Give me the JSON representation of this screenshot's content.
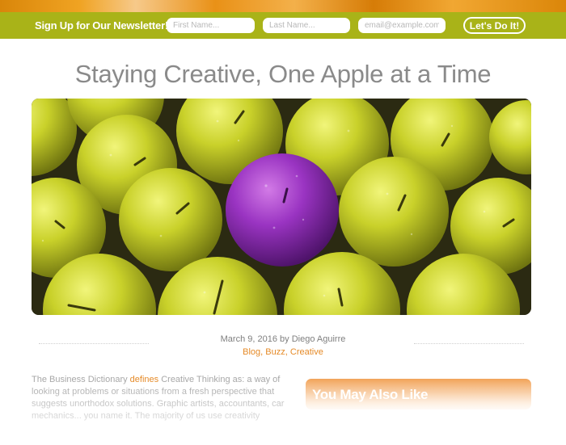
{
  "newsletter": {
    "title": "Sign Up for Our Newsletter!",
    "first_name_placeholder": "First Name...",
    "last_name_placeholder": "Last Name...",
    "email_placeholder": "email@example.com",
    "submit_label": "Let's Do It!"
  },
  "post": {
    "title": "Staying Creative, One Apple at a Time",
    "date": "March 9, 2016",
    "by": "by",
    "author": "Diego Aguirre",
    "categories": [
      "Blog",
      "Buzz",
      "Creative"
    ],
    "body_before_link": "The Business Dictionary ",
    "body_link": "defines",
    "body_after_link": " Creative Thinking as: a way of looking at problems or situations from a fresh perspective that suggests unorthodox solutions. Graphic artists, accountants, car mechanics... you name it. The majority of us use creativity"
  },
  "sidebar": {
    "also_like_title": "You May Also Like"
  },
  "colors": {
    "brand_green": "#a9b318",
    "accent_orange": "#e58a27",
    "title_gray": "#8a8a8a",
    "apple_green": "#c8d22a",
    "apple_purple": "#8a2fb0"
  }
}
